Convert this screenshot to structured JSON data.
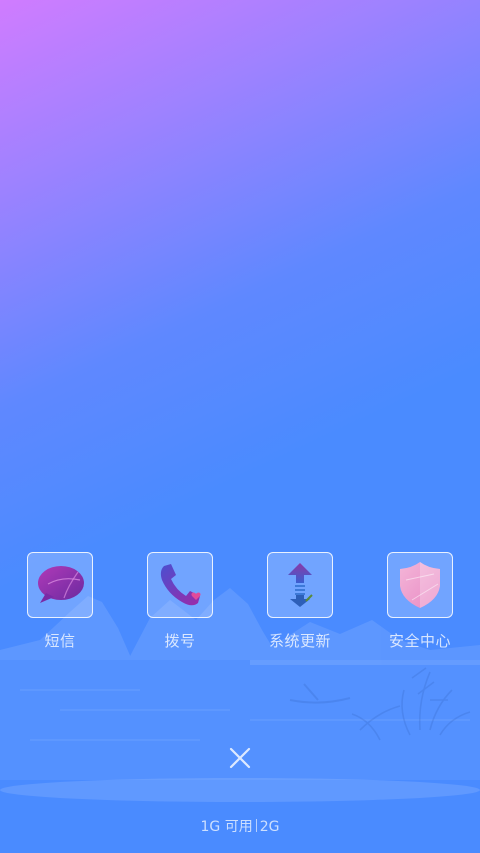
{
  "apps": [
    {
      "label": "短信",
      "icon": "message-bubble-icon"
    },
    {
      "label": "拨号",
      "icon": "phone-icon"
    },
    {
      "label": "系统更新",
      "icon": "update-arrows-icon"
    },
    {
      "label": "安全中心",
      "icon": "shield-icon"
    }
  ],
  "memory": {
    "used_text": "1G 可用",
    "total_text": "2G"
  },
  "colors": {
    "gradient_top": "#d07cff",
    "gradient_bottom": "#4a8bff"
  }
}
